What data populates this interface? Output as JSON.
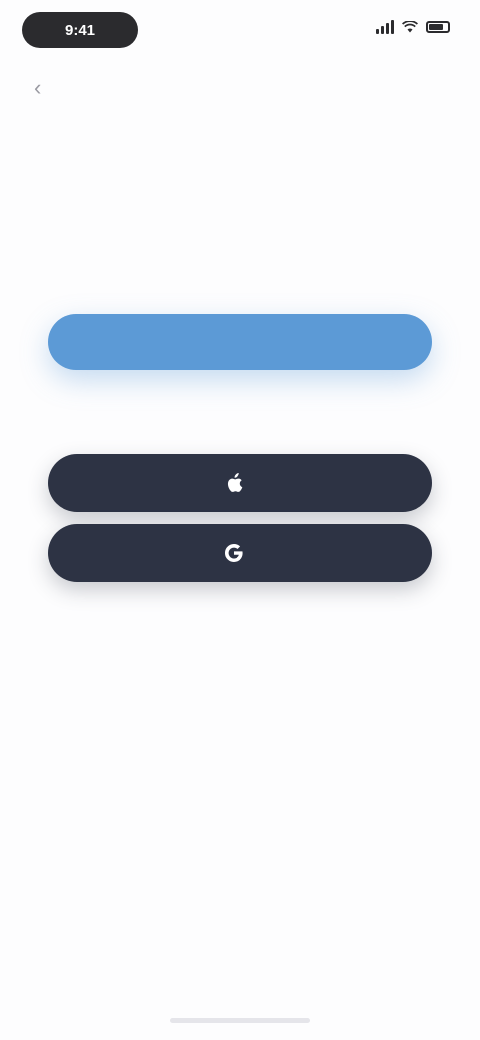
{
  "status_bar": {
    "time": "9:41",
    "icons": [
      "signal-icon",
      "wifi-icon",
      "battery-icon"
    ]
  },
  "nav": {
    "back_icon": "chevron-left-icon"
  },
  "header": {
    "title": "",
    "subtitle": ""
  },
  "actions": {
    "primary_label": "",
    "divider_text": "",
    "apple_label": "",
    "apple_icon": "apple-icon",
    "google_label": "",
    "google_icon": "google-icon"
  },
  "footer": {
    "text": "",
    "link": ""
  },
  "colors": {
    "primary": "#5c9ad6",
    "social_button": "#2d3344",
    "title_text": "#2a2a32",
    "muted_text": "#a9a9b2"
  }
}
